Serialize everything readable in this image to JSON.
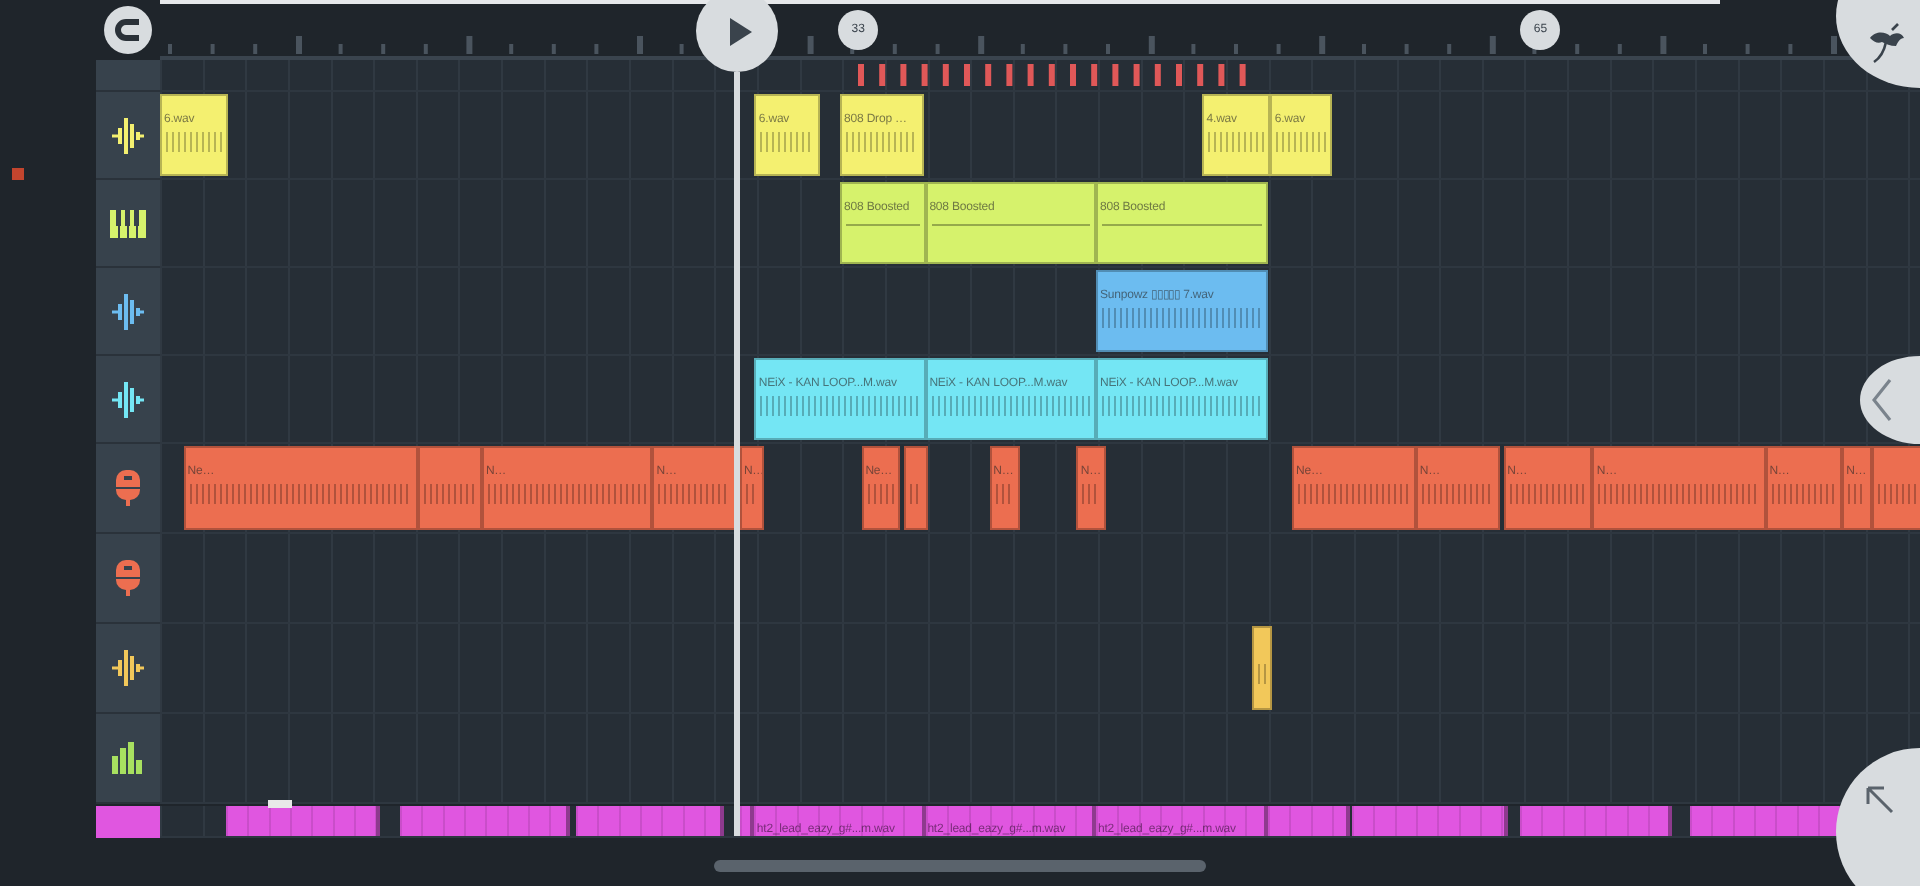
{
  "ruler": {
    "markers": [
      {
        "label": "33"
      },
      {
        "label": "65"
      }
    ]
  },
  "tracks": [
    {
      "kind": "audio",
      "color": "#f4f070",
      "clips": [
        {
          "kind": "audio",
          "label": "6.wav"
        },
        {
          "kind": "audio",
          "label": "6.wav"
        },
        {
          "kind": "audio",
          "label": "808 Drop …"
        },
        {
          "kind": "audio",
          "label": "4.wav"
        },
        {
          "kind": "audio",
          "label": "6.wav"
        }
      ]
    },
    {
      "kind": "piano",
      "color": "#d6f26c",
      "clips": [
        {
          "kind": "pattern",
          "label": "808 Boosted"
        },
        {
          "kind": "pattern",
          "label": "808 Boosted"
        },
        {
          "kind": "pattern",
          "label": "808 Boosted"
        }
      ]
    },
    {
      "kind": "audio",
      "color": "#6cbcf0",
      "clips": [
        {
          "kind": "audio",
          "label": "Sunpowz ▯▯▯▯▯ 7.wav"
        }
      ]
    },
    {
      "kind": "audio",
      "color": "#74e6f4",
      "clips": [
        {
          "kind": "audio",
          "label": "NEiX - KAN LOOP...M.wav"
        },
        {
          "kind": "audio",
          "label": "NEiX - KAN LOOP...M.wav"
        },
        {
          "kind": "audio",
          "label": "NEiX - KAN LOOP...M.wav"
        }
      ]
    },
    {
      "kind": "mic",
      "color": "#ec6e50",
      "clips": [
        {
          "kind": "audio",
          "label": "Ne…"
        },
        {
          "kind": "audio"
        },
        {
          "kind": "audio",
          "label": "N…"
        },
        {
          "kind": "audio",
          "label": "N…"
        },
        {
          "kind": "audio",
          "label": "N…"
        },
        {
          "kind": "audio",
          "label": "Ne…"
        },
        {
          "kind": "audio"
        },
        {
          "kind": "audio",
          "label": "N…"
        },
        {
          "kind": "audio",
          "label": "N…"
        },
        {
          "kind": "audio",
          "label": "Ne…"
        },
        {
          "kind": "audio",
          "label": "N…"
        },
        {
          "kind": "audio",
          "label": "N…"
        },
        {
          "kind": "audio",
          "label": "N…"
        },
        {
          "kind": "audio",
          "label": "N…"
        },
        {
          "kind": "audio",
          "label": "N…"
        },
        {
          "kind": "audio"
        }
      ]
    },
    {
      "kind": "mic",
      "color": "#ec6e50"
    },
    {
      "kind": "audio",
      "color": "#f2c85a",
      "clips": [
        {
          "kind": "audio"
        }
      ]
    },
    {
      "kind": "meter",
      "color": "#a8e060"
    }
  ],
  "bottom_track": {
    "color": "#e056e0",
    "clips": [
      {
        "kind": "audio"
      },
      {
        "kind": "audio"
      },
      {
        "kind": "audio"
      },
      {
        "kind": "audio"
      },
      {
        "kind": "audio",
        "label": "ht2_lead_eazy_g#...m.wav"
      },
      {
        "kind": "audio",
        "label": "ht2_lead_eazy_g#...m.wav"
      },
      {
        "kind": "audio",
        "label": "ht2_lead_eazy_g#...m.wav"
      },
      {
        "kind": "audio"
      },
      {
        "kind": "audio"
      },
      {
        "kind": "audio"
      },
      {
        "kind": "audio"
      }
    ]
  }
}
